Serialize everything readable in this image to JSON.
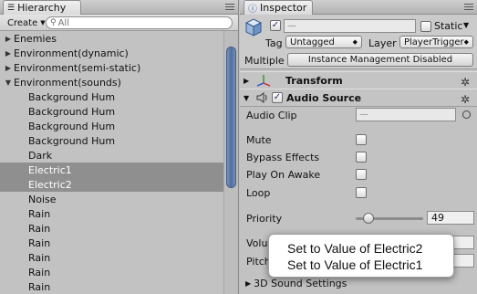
{
  "hierarchy": {
    "tab_label": "Hierarchy",
    "create_label": "Create",
    "search_placeholder": "All",
    "items": [
      {
        "label": "Enemies",
        "expanded": false,
        "child": false,
        "selected": false
      },
      {
        "label": "Environment(dynamic)",
        "expanded": false,
        "child": false,
        "selected": false
      },
      {
        "label": "Environment(semi-static)",
        "expanded": false,
        "child": false,
        "selected": false
      },
      {
        "label": "Environment(sounds)",
        "expanded": true,
        "child": false,
        "selected": false
      },
      {
        "label": "Background Hum",
        "child": true,
        "selected": false
      },
      {
        "label": "Background Hum",
        "child": true,
        "selected": false
      },
      {
        "label": "Background Hum",
        "child": true,
        "selected": false
      },
      {
        "label": "Background Hum",
        "child": true,
        "selected": false
      },
      {
        "label": "Dark",
        "child": true,
        "selected": false
      },
      {
        "label": "Electric1",
        "child": true,
        "selected": true
      },
      {
        "label": "Electric2",
        "child": true,
        "selected": true
      },
      {
        "label": "Noise",
        "child": true,
        "selected": false
      },
      {
        "label": "Rain",
        "child": true,
        "selected": false
      },
      {
        "label": "Rain",
        "child": true,
        "selected": false
      },
      {
        "label": "Rain",
        "child": true,
        "selected": false
      },
      {
        "label": "Rain",
        "child": true,
        "selected": false
      },
      {
        "label": "Rain",
        "child": true,
        "selected": false
      },
      {
        "label": "Rain",
        "child": true,
        "selected": false
      }
    ]
  },
  "inspector": {
    "tab_label": "Inspector",
    "name_value": "—",
    "static_label": "Static",
    "tag_label": "Tag",
    "tag_value": "Untagged",
    "layer_label": "Layer",
    "layer_value": "PlayerTrigger",
    "multiple_label": "Multiple",
    "instance_button": "Instance Management Disabled",
    "transform_title": "Transform",
    "audio_title": "Audio Source",
    "audio_clip_label": "Audio Clip",
    "audio_clip_value": "—",
    "mute_label": "Mute",
    "bypass_label": "Bypass Effects",
    "play_on_awake_label": "Play On Awake",
    "loop_label": "Loop",
    "priority_label": "Priority",
    "priority_value": "49",
    "priority_fraction": 0.19,
    "volume_label_partial": "Volu",
    "pitch_label_partial": "Pitch",
    "sound3d_label": "3D Sound Settings"
  },
  "popup": {
    "items": [
      "Set to Value of Electric2",
      "Set to Value of Electric1"
    ]
  }
}
